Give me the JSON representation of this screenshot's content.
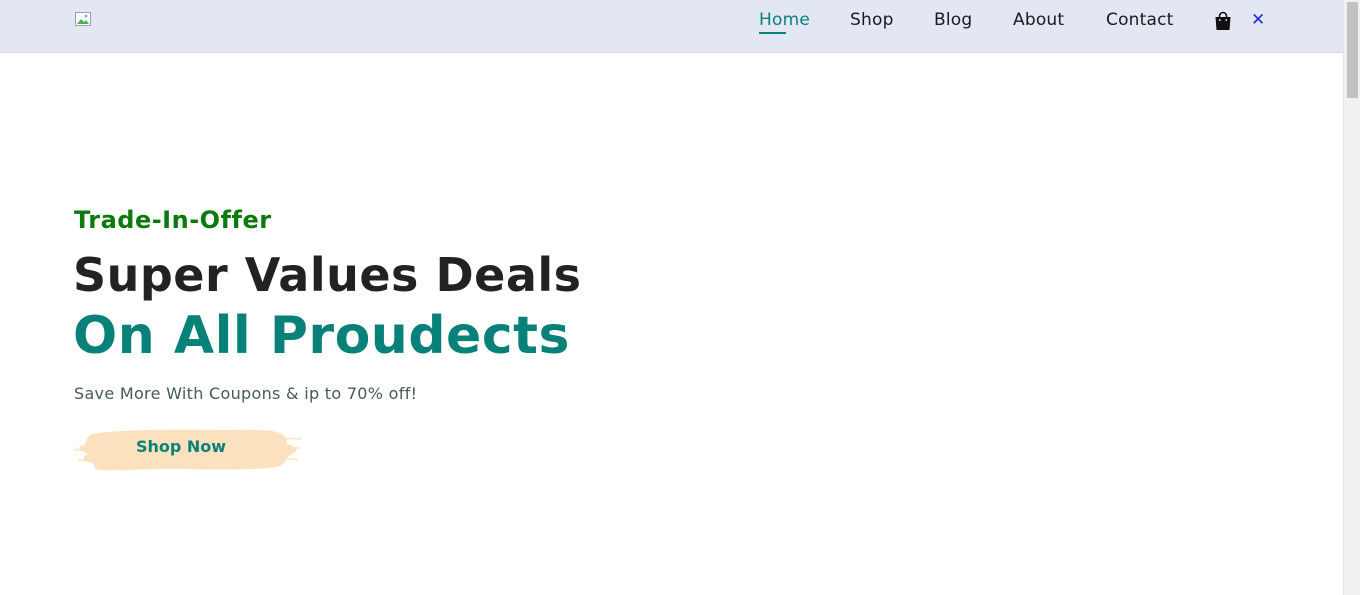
{
  "header": {
    "nav": {
      "home": "Home",
      "shop": "Shop",
      "blog": "Blog",
      "about": "About",
      "contact": "Contact"
    },
    "icons": {
      "logo": "broken-image-icon",
      "bag": "shopping-bag-icon",
      "close": "close-icon",
      "close_glyph": "✕"
    }
  },
  "hero": {
    "kicker": "Trade-In-Offer",
    "headline": "Super Values Deals",
    "headline_accent": "On All Proudects",
    "subtext": "Save More With Coupons & ip to 70% off!",
    "cta_label": "Shop Now"
  },
  "colors": {
    "header_bg": "#e3e6f3",
    "accent": "#088178",
    "kicker": "#0a7a0a",
    "cta_bg": "#fbe1bd"
  }
}
